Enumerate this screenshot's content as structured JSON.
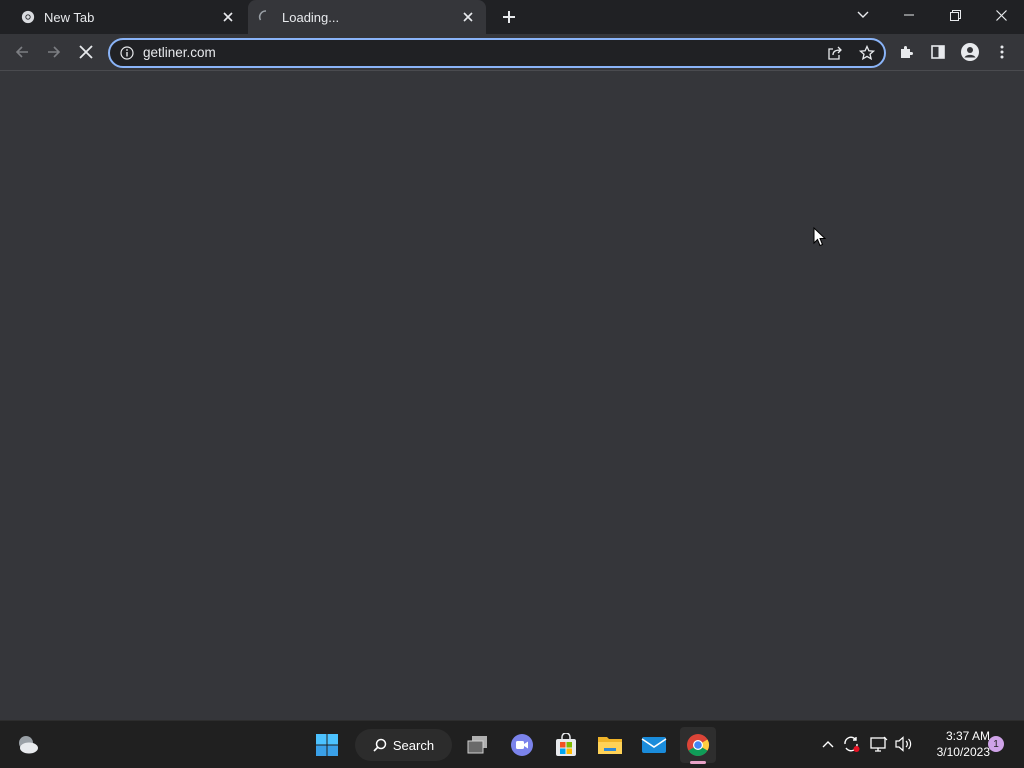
{
  "browser": {
    "tabs": [
      {
        "title": "New Tab"
      },
      {
        "title": "Loading..."
      }
    ],
    "address_bar": {
      "url": "getliner.com"
    }
  },
  "taskbar": {
    "search_label": "Search",
    "clock_time": "3:37 AM",
    "clock_date": "3/10/2023",
    "notification_count": "1"
  },
  "colors": {
    "tabstrip_bg": "#202124",
    "toolbar_bg": "#35363a",
    "omnibox_focus": "#8ab4f8",
    "taskbar_bg": "#202020"
  }
}
